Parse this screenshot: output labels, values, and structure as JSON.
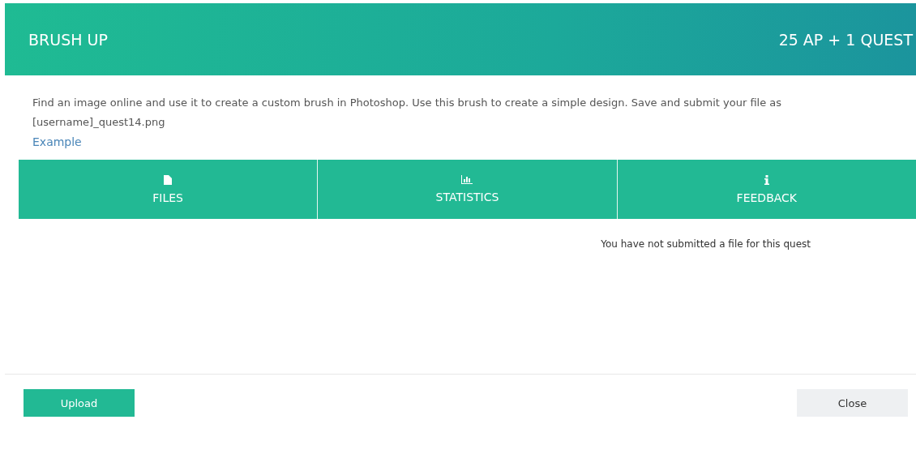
{
  "header": {
    "title": "BRUSH UP",
    "reward": "25 AP + 1 QUEST"
  },
  "description": {
    "text": "Find an image online and use it to create a custom brush in Photoshop. Use this brush to create a simple design. Save and submit your file as [username]_quest14.png",
    "link": "Example"
  },
  "tabs": [
    {
      "label": "FILES",
      "kind": "file"
    },
    {
      "label": "STATISTICS",
      "kind": "chart"
    },
    {
      "label": "FEEDBACK",
      "kind": "info"
    }
  ],
  "message": "You have not submitted a file for this quest",
  "buttons": [
    {
      "label": "Upload",
      "kind": "primary"
    },
    {
      "label": "Close",
      "kind": "secondary"
    }
  ]
}
